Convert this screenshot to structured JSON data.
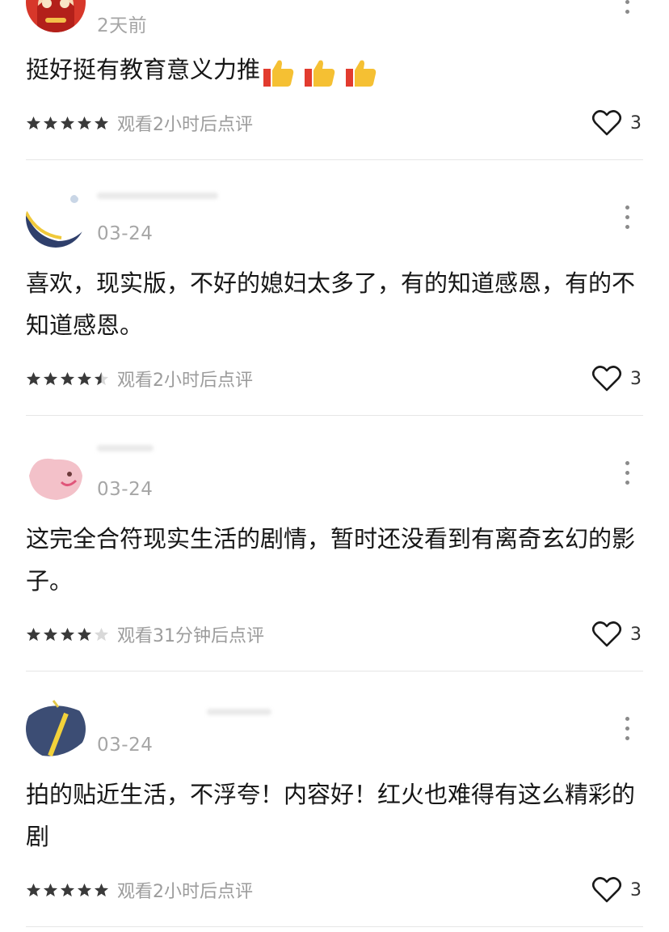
{
  "comments": [
    {
      "time": "2天前",
      "text": "挺好挺有教育意义力推",
      "thumbs_count": 3,
      "rating": 5,
      "watch": "观看2小时后点评",
      "likes": "3"
    },
    {
      "time": "03-24",
      "text": "喜欢，现实版，不好的媳妇太多了，有的知道感恩，有的不知道感恩。",
      "rating": 4.5,
      "watch": "观看2小时后点评",
      "likes": "3"
    },
    {
      "time": "03-24",
      "text": "这完全合符现实生活的剧情，暂时还没看到有离奇玄幻的影子。",
      "rating": 4,
      "watch": "观看31分钟后点评",
      "likes": "3"
    },
    {
      "time": "03-24",
      "text": "拍的贴近生活，不浮夸！内容好！红火也难得有这么精彩的剧",
      "rating": 5,
      "watch": "观看2小时后点评",
      "likes": "3"
    }
  ],
  "colors": {
    "star_filled": "#3a3a3a",
    "star_empty": "#d9d9d9",
    "meta_text": "#9c9c9c",
    "divider": "#e6e6e6"
  },
  "icons": {
    "more": "more-vertical-icon",
    "like": "heart-outline-icon",
    "star": "star-icon",
    "thumbs": "thumbs-up-emoji-icon"
  }
}
